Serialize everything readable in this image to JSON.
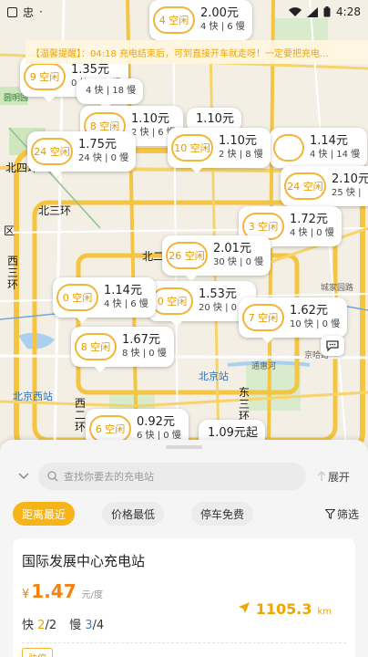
{
  "status_bar": {
    "time": "4:28",
    "app_glyph": "忠"
  },
  "notice": {
    "text": "【温馨提醒】：04:18 充电结束后，可到直接开车就走呀！一定要把充电..."
  },
  "map": {
    "labels": {
      "beisihuan": "北四环",
      "beisanhuan": "北三环",
      "beierhuan": "北二环",
      "xisanhuan": "西三环",
      "xierhuan": "西二环",
      "dongsanhuan": "东三环",
      "beijing_west": "北京西站",
      "beijing_station": "北京站",
      "tonghui_river": "通惠河",
      "road_left": "区",
      "yuanmingyuan": "圆明园",
      "jingha_road": "京哈路",
      "chengjia_road": "城家园路"
    },
    "markers": [
      {
        "badge": "4 空闲",
        "price": "2.00元",
        "counts": "4 快 | 6 慢"
      },
      {
        "badge": "9 空闲",
        "price": "1.35元",
        "counts": "0 快 | 10 慢"
      },
      {
        "badge": "",
        "price": "",
        "counts": "4 快 | 18 慢"
      },
      {
        "badge": "8 空闲",
        "price": "1.10元",
        "counts": "2 快 | 6 慢"
      },
      {
        "badge": "",
        "price": "1.10元",
        "counts": ""
      },
      {
        "badge": "24 空闲",
        "price": "1.75元",
        "counts": "24 快 | 0 慢"
      },
      {
        "badge": "10 空闲",
        "price": "1.10元",
        "counts": "2 快 | 8 慢"
      },
      {
        "badge": "",
        "price": "1.14元",
        "counts": "4 快 | 14 慢"
      },
      {
        "badge": "24 空闲",
        "price": "2.10元",
        "counts": "25 快 |"
      },
      {
        "badge": "3 空闲",
        "price": "1.72元",
        "counts": "4 快 | 0 慢"
      },
      {
        "badge": "26 空闲",
        "price": "2.01元",
        "counts": "30 快 | 0 慢"
      },
      {
        "badge": "0 空闲",
        "price": "1.14元",
        "counts": "4 快 | 6 慢"
      },
      {
        "badge": "0 空闲",
        "price": "1.53元",
        "counts": "20 快 | 0 慢"
      },
      {
        "badge": "7 空闲",
        "price": "1.62元",
        "counts": "10 快 | 0 慢"
      },
      {
        "badge": "8 空闲",
        "price": "1.67元",
        "counts": "8 快 | 0 慢"
      },
      {
        "badge": "6 空闲",
        "price": "0.92元",
        "counts": "6 快 | 0 慢"
      },
      {
        "badge": "",
        "price": "1.09元起",
        "counts": ""
      }
    ]
  },
  "sheet": {
    "search_placeholder": "查找你要去的充电站",
    "expand_label": "展开",
    "filters": [
      "距离最近",
      "价格最低",
      "停车免费"
    ],
    "filter_button": "筛选",
    "station": {
      "name": "国际发展中心充电站",
      "currency": "¥",
      "price": "1.47",
      "price_unit": "元/度",
      "distance": "1105.3",
      "distance_unit": "km",
      "fast_label": "快",
      "fast_free": "2",
      "fast_total": "/2",
      "slow_label": "慢",
      "slow_free": "3",
      "slow_total": "/4",
      "tag": "驻停"
    }
  },
  "colors": {
    "accent": "#f6b419",
    "badge_text": "#e29a00",
    "price": "#f5820a"
  }
}
